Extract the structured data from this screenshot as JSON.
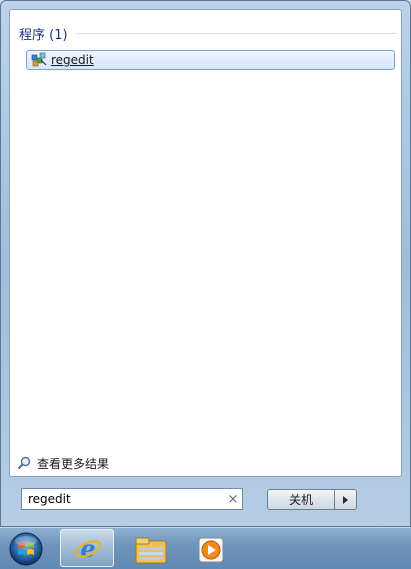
{
  "results": {
    "section_title": "程序 (1)",
    "items": [
      {
        "label": "regedit",
        "icon": "regedit-icon"
      }
    ]
  },
  "see_more": {
    "label": "查看更多结果",
    "icon": "search-icon"
  },
  "search": {
    "value": "regedit",
    "clear_icon": "×"
  },
  "shutdown": {
    "label": "关机",
    "arrow_icon": "chevron-right-icon"
  },
  "taskbar": {
    "items": [
      "start-orb",
      "internet-explorer-icon",
      "windows-explorer-icon",
      "media-player-icon"
    ]
  },
  "colors": {
    "section_title": "#1e3287",
    "selection_border": "#7da2ce",
    "taskbar": "#6f95bc"
  }
}
